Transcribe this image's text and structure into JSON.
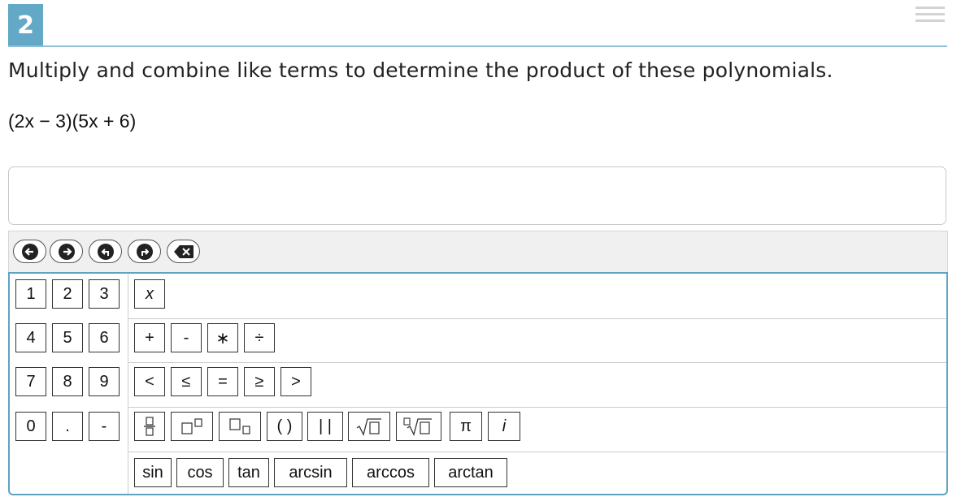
{
  "question": {
    "number": "2",
    "prompt": "Multiply and combine like terms to determine the product of these polynomials.",
    "expression": "(2x − 3)(5x + 6)"
  },
  "icons": {
    "menu": "hamburger-menu-icon",
    "toolbar": [
      "arrow-left-icon",
      "arrow-right-icon",
      "undo-icon",
      "redo-icon",
      "backspace-icon"
    ]
  },
  "answer": {
    "value": "",
    "placeholder": ""
  },
  "keypad": {
    "digits": [
      "1",
      "2",
      "3",
      "4",
      "5",
      "6",
      "7",
      "8",
      "9",
      "0",
      ".",
      "-"
    ],
    "variables": [
      "x"
    ],
    "operators": [
      "+",
      "-",
      "∗",
      "÷"
    ],
    "relations": [
      "<",
      "≤",
      "=",
      "≥",
      ">"
    ],
    "templates": [
      "fraction",
      "superscript",
      "subscript",
      "( )",
      "| |",
      "sqrt",
      "nth-root",
      "π",
      "i"
    ],
    "paren_label": "( )",
    "abs_label": "| |",
    "pi_label": "π",
    "i_label": "i",
    "functions": [
      "sin",
      "cos",
      "tan",
      "arcsin",
      "arccos",
      "arctan"
    ]
  },
  "colors": {
    "accent": "#63a9c7",
    "border_accent": "#5ea3c2"
  }
}
